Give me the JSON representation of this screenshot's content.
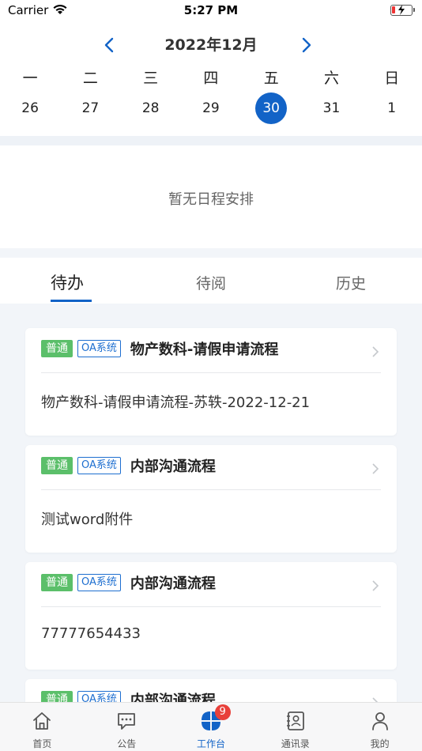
{
  "status_bar": {
    "carrier": "Carrier",
    "time": "5:27 PM"
  },
  "calendar": {
    "month_title": "2022年12月",
    "weekdays": [
      "一",
      "二",
      "三",
      "四",
      "五",
      "六",
      "日"
    ],
    "dates": [
      "26",
      "27",
      "28",
      "29",
      "30",
      "31",
      "1"
    ],
    "selected_date": "30",
    "accent_color": "#1263c7"
  },
  "schedule": {
    "empty_text": "暂无日程安排"
  },
  "tabs": {
    "todo": "待办",
    "toread": "待阅",
    "history": "历史",
    "active": "todo"
  },
  "tasks": [
    {
      "priority": "普通",
      "system": "OA系统",
      "title": "物产数科-请假申请流程",
      "desc": "物产数科-请假申请流程-苏轶-2022-12-21"
    },
    {
      "priority": "普通",
      "system": "OA系统",
      "title": "内部沟通流程",
      "desc": "测试word附件"
    },
    {
      "priority": "普通",
      "system": "OA系统",
      "title": "内部沟通流程",
      "desc": "77777654433"
    },
    {
      "priority": "普通",
      "system": "OA系统",
      "title": "内部沟通流程",
      "desc": ""
    }
  ],
  "bottom_nav": {
    "home": "首页",
    "notice": "公告",
    "workbench": "工作台",
    "workbench_badge": "9",
    "contacts": "通讯录",
    "mine": "我的",
    "active": "workbench"
  },
  "colors": {
    "priority_badge": "#5bbf6a",
    "system_badge": "#1e6fd0",
    "nav_badge": "#e8403a"
  }
}
